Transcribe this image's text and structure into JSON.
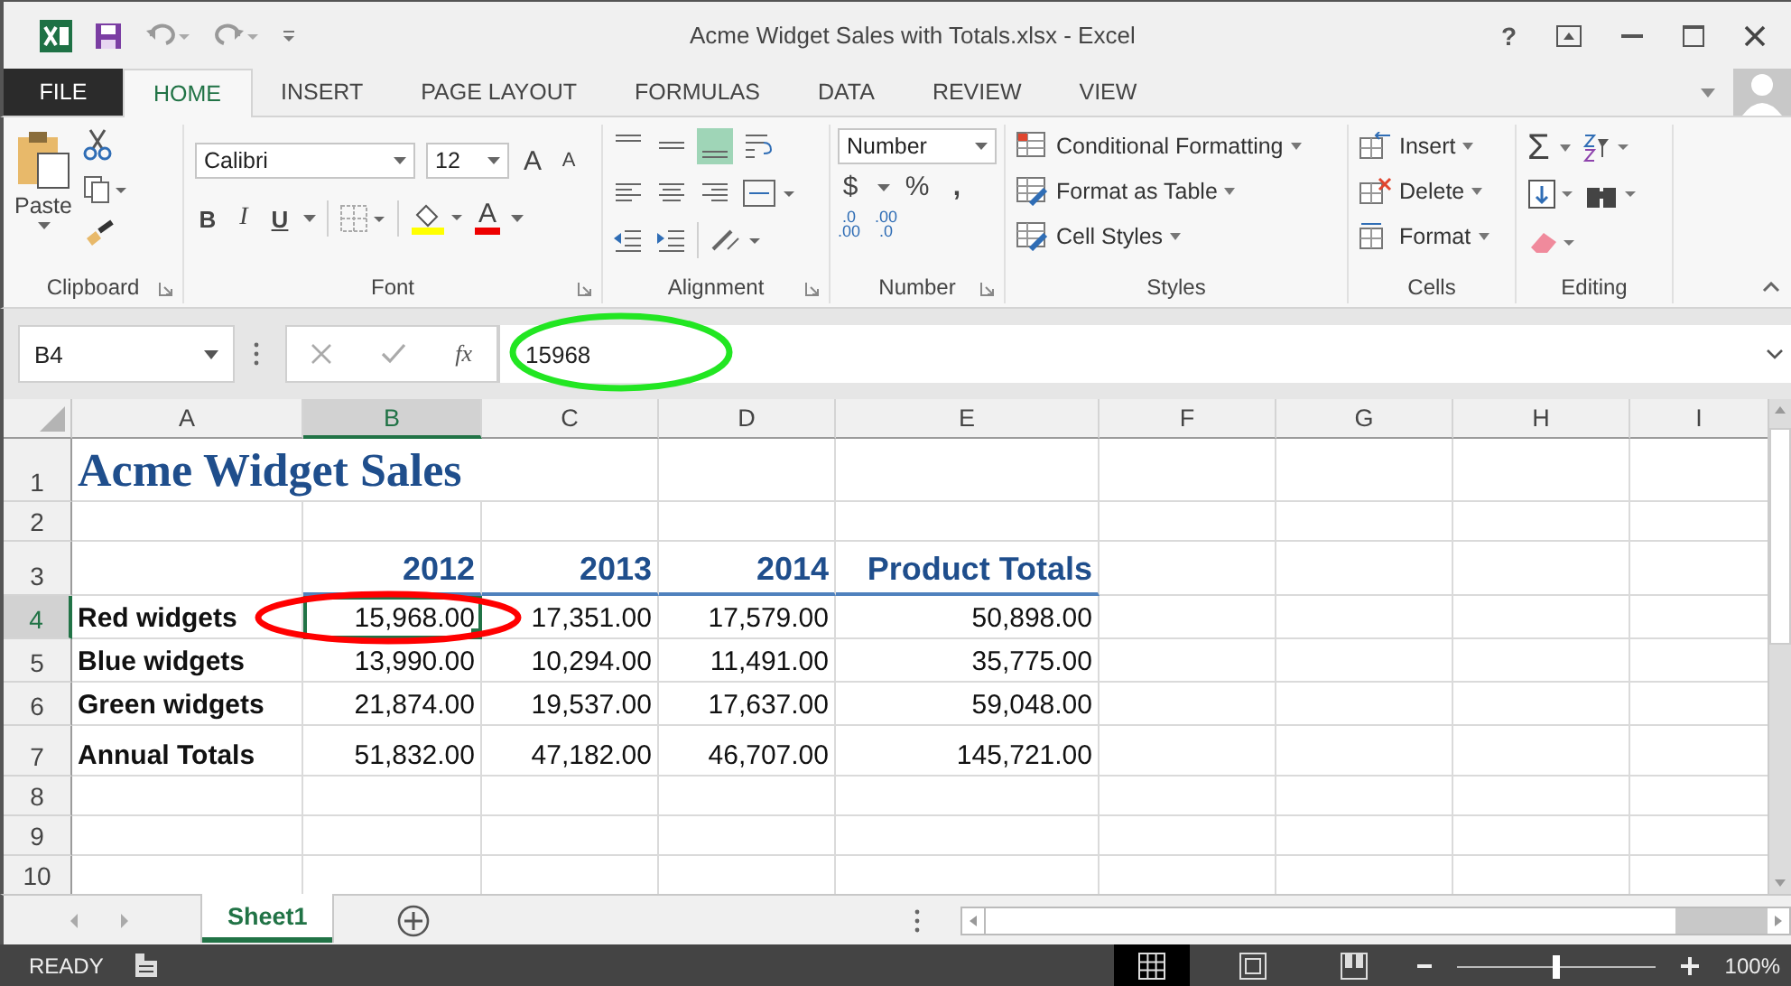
{
  "title_bar": {
    "title": "Acme Widget Sales with Totals.xlsx - Excel",
    "help": "?"
  },
  "ribbon_tabs": [
    {
      "label": "FILE",
      "kind": "file",
      "selected": false
    },
    {
      "label": "HOME",
      "kind": "tab",
      "selected": true
    },
    {
      "label": "INSERT",
      "kind": "tab",
      "selected": false
    },
    {
      "label": "PAGE LAYOUT",
      "kind": "tab",
      "selected": false
    },
    {
      "label": "FORMULAS",
      "kind": "tab",
      "selected": false
    },
    {
      "label": "DATA",
      "kind": "tab",
      "selected": false
    },
    {
      "label": "REVIEW",
      "kind": "tab",
      "selected": false
    },
    {
      "label": "VIEW",
      "kind": "tab",
      "selected": false
    }
  ],
  "ribbon": {
    "groups": [
      {
        "kind": "clipboard",
        "label": "Clipboard"
      },
      {
        "kind": "font",
        "label": "Font"
      },
      {
        "kind": "alignment",
        "label": "Alignment"
      },
      {
        "kind": "number",
        "label": "Number"
      },
      {
        "kind": "styles",
        "label": "Styles"
      },
      {
        "kind": "cells",
        "label": "Cells"
      },
      {
        "kind": "editing",
        "label": "Editing"
      }
    ],
    "paste": "Paste",
    "font_name": "Calibri",
    "font_size": "12",
    "grow_font": "A",
    "shrink_font": "A",
    "bold": "B",
    "italic": "I",
    "underline": "U",
    "font_color": "A",
    "vertical_align": [
      {
        "kind": "top",
        "selected": false
      },
      {
        "kind": "middle",
        "selected": false
      },
      {
        "kind": "bottom",
        "selected": true
      }
    ],
    "number_format": "Number",
    "currency": "$",
    "percent": "%",
    "comma": ",",
    "increase_decimal": {
      "top": ".0",
      "bottom": ".00"
    },
    "decrease_decimal": {
      "top": ".00",
      "bottom": ".0"
    },
    "styles": [
      {
        "kind": "conditional",
        "label": "Conditional Formatting"
      },
      {
        "kind": "table",
        "label": "Format as Table"
      },
      {
        "kind": "cell",
        "label": "Cell Styles"
      }
    ],
    "cells": [
      {
        "kind": "insert",
        "label": "Insert"
      },
      {
        "kind": "delete",
        "label": "Delete"
      },
      {
        "kind": "format",
        "label": "Format"
      }
    ],
    "autosum": "Σ"
  },
  "formula_bar": {
    "name_box": "B4",
    "function_label": "fx",
    "value": "15968"
  },
  "columns": [
    {
      "label": "A",
      "selected": false
    },
    {
      "label": "B",
      "selected": true
    },
    {
      "label": "C",
      "selected": false
    },
    {
      "label": "D",
      "selected": false
    },
    {
      "label": "E",
      "selected": false
    },
    {
      "label": "F",
      "selected": false
    },
    {
      "label": "G",
      "selected": false
    },
    {
      "label": "H",
      "selected": false
    },
    {
      "label": "I",
      "selected": false
    }
  ],
  "rows": [
    {
      "number": "1",
      "kind": "title",
      "selected": false,
      "cells": [
        {
          "text": "Acme Widget Sales",
          "selected": false
        }
      ]
    },
    {
      "number": "2",
      "kind": "blank",
      "selected": false
    },
    {
      "number": "3",
      "kind": "header",
      "selected": false,
      "cells": [
        {
          "text": "2012",
          "selected": false
        },
        {
          "text": "2013",
          "selected": false
        },
        {
          "text": "2014",
          "selected": false
        },
        {
          "text": "Product Totals",
          "selected": false
        }
      ]
    },
    {
      "number": "4",
      "kind": "data",
      "selected": true,
      "cells": [
        {
          "text": "Red widgets",
          "selected": false
        },
        {
          "text": "15,968.00",
          "selected": true
        },
        {
          "text": "17,351.00",
          "selected": false
        },
        {
          "text": "17,579.00",
          "selected": false
        },
        {
          "text": "50,898.00",
          "selected": false
        }
      ]
    },
    {
      "number": "5",
      "kind": "data",
      "selected": false,
      "cells": [
        {
          "text": "Blue widgets",
          "selected": false
        },
        {
          "text": "13,990.00",
          "selected": false
        },
        {
          "text": "10,294.00",
          "selected": false
        },
        {
          "text": "11,491.00",
          "selected": false
        },
        {
          "text": "35,775.00",
          "selected": false
        }
      ]
    },
    {
      "number": "6",
      "kind": "data",
      "selected": false,
      "cells": [
        {
          "text": "Green widgets",
          "selected": false
        },
        {
          "text": "21,874.00",
          "selected": false
        },
        {
          "text": "19,537.00",
          "selected": false
        },
        {
          "text": "17,637.00",
          "selected": false
        },
        {
          "text": "59,048.00",
          "selected": false
        }
      ]
    },
    {
      "number": "7",
      "kind": "total",
      "selected": false,
      "cells": [
        {
          "text": "Annual Totals",
          "selected": false
        },
        {
          "text": "51,832.00",
          "selected": false
        },
        {
          "text": "47,182.00",
          "selected": false
        },
        {
          "text": "46,707.00",
          "selected": false
        },
        {
          "text": "145,721.00",
          "selected": false
        }
      ]
    },
    {
      "number": "8",
      "kind": "blank",
      "selected": false
    },
    {
      "number": "9",
      "kind": "blank",
      "selected": false
    },
    {
      "number": "10",
      "kind": "blank",
      "selected": false
    }
  ],
  "sheet_tabs": [
    {
      "label": "Sheet1",
      "selected": true
    }
  ],
  "status_bar": {
    "mode": "READY",
    "views": [
      {
        "kind": "normal",
        "selected": true
      },
      {
        "kind": "page_layout",
        "selected": false
      },
      {
        "kind": "page_break",
        "selected": false
      }
    ],
    "zoom": {
      "level": 0.5,
      "reading": "100%"
    }
  },
  "annotations": [
    {
      "kind": "cell_circle",
      "color": "#ff0000"
    },
    {
      "kind": "formula_circle",
      "color": "#22e622"
    }
  ]
}
